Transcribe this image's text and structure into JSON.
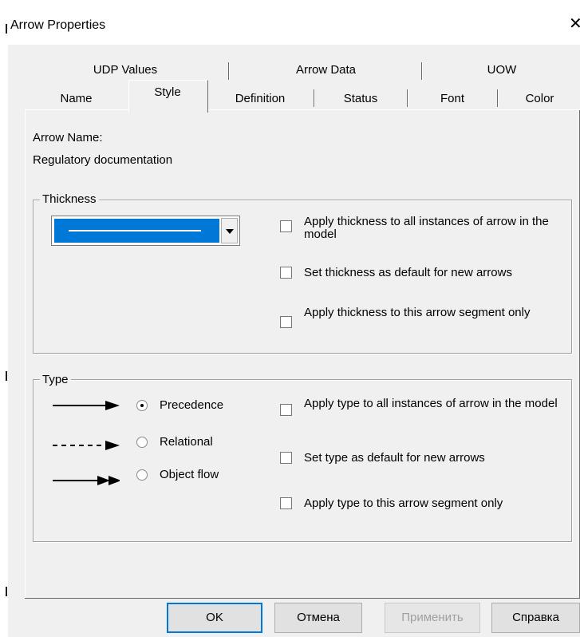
{
  "window": {
    "title": "Arrow Properties",
    "close_glyph": "✕",
    "close_icon": "close-icon"
  },
  "tabs": {
    "row_back": [
      {
        "label": "UDP Values"
      },
      {
        "label": "Arrow Data"
      },
      {
        "label": "UOW"
      }
    ],
    "row_front": [
      {
        "label": "Name"
      },
      {
        "label": "Style",
        "selected": true
      },
      {
        "label": "Definition"
      },
      {
        "label": "Status"
      },
      {
        "label": "Font"
      },
      {
        "label": "Color"
      }
    ]
  },
  "arrow": {
    "name_label": "Arrow Name:",
    "name_value": "Regulatory documentation"
  },
  "thickness": {
    "legend": "Thickness",
    "selected_value_color": "#0078d7",
    "options": [
      {
        "label": "Apply thickness to all instances of arrow in the model",
        "checked": false
      },
      {
        "label": "Set thickness as default for new arrows",
        "checked": false
      },
      {
        "label": "Apply thickness to this arrow segment only",
        "checked": false
      }
    ]
  },
  "type": {
    "legend": "Type",
    "radios": [
      {
        "label": "Precedence",
        "checked": true,
        "line_style": "solid",
        "head": "single"
      },
      {
        "label": "Relational",
        "checked": false,
        "line_style": "dashed",
        "head": "single"
      },
      {
        "label": "Object flow",
        "checked": false,
        "line_style": "solid",
        "head": "double"
      }
    ],
    "options": [
      {
        "label": "Apply type to all instances of arrow in the model",
        "checked": false
      },
      {
        "label": "Set type as default for new arrows",
        "checked": false
      },
      {
        "label": "Apply type to this arrow segment only",
        "checked": false
      }
    ]
  },
  "buttons": {
    "ok": "OK",
    "cancel": "Отмена",
    "apply": "Применить",
    "help": "Справка"
  },
  "colors": {
    "dialog_bg": "#f0f0f0",
    "accent": "#0078d7"
  }
}
